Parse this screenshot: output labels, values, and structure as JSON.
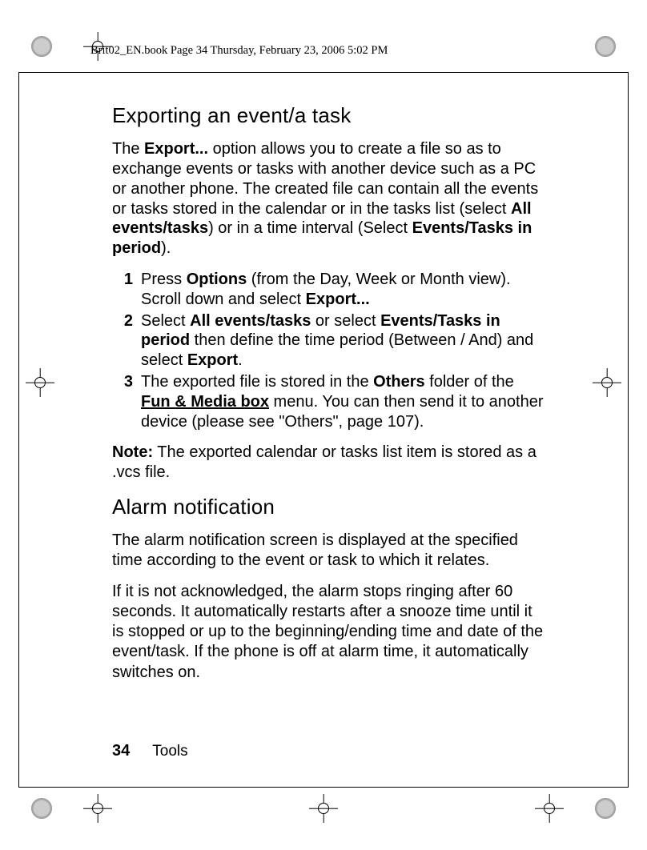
{
  "header": {
    "running_head": "Brit02_EN.book  Page 34  Thursday, February 23, 2006  5:02 PM"
  },
  "section1": {
    "title": "Exporting an event/a task",
    "intro_parts": {
      "t1": "The ",
      "b1": "Export...",
      "t2": " option allows you to create a file so as to exchange events or tasks with another device such as a PC or another phone. The created file can contain all the events or tasks stored in the calendar or in the tasks list (select ",
      "b2": "All events/tasks",
      "t3": ") or in a time interval (Select ",
      "b3": "Events/Tasks in period",
      "t4": ")."
    },
    "steps": [
      {
        "num": "1",
        "parts": {
          "t1": "Press ",
          "b1": "Options",
          "t2": " (from the Day, Week or Month view). Scroll down and select ",
          "b2": "Export..."
        }
      },
      {
        "num": "2",
        "parts": {
          "t1": "Select ",
          "b1": "All events/tasks",
          "t2": " or select ",
          "b2": "Events/Tasks in period",
          "t3": " then define the time period (Between / And) and select ",
          "b3": "Export",
          "t4": "."
        }
      },
      {
        "num": "3",
        "parts": {
          "t1": "The exported file is stored in the ",
          "b1": "Others",
          "t2": " folder of the ",
          "bu1": "Fun & Media box",
          "t3": " menu. You can then send it to another device (please see \"Others\", page 107)."
        }
      }
    ],
    "note": {
      "label": "Note:",
      "text": " The exported calendar or tasks list item is stored as a .vcs file."
    }
  },
  "section2": {
    "title": "Alarm notification",
    "para1": "The alarm notification screen is displayed at the specified time according to the event or task to which it relates.",
    "para2": "If it is not acknowledged, the alarm stops ringing after 60 seconds. It automatically restarts after a snooze time until it is stopped or up to the beginning/ending time and date of the event/task. If the phone is off at alarm time, it automatically switches on."
  },
  "footer": {
    "page_number": "34",
    "section_name": "Tools"
  }
}
